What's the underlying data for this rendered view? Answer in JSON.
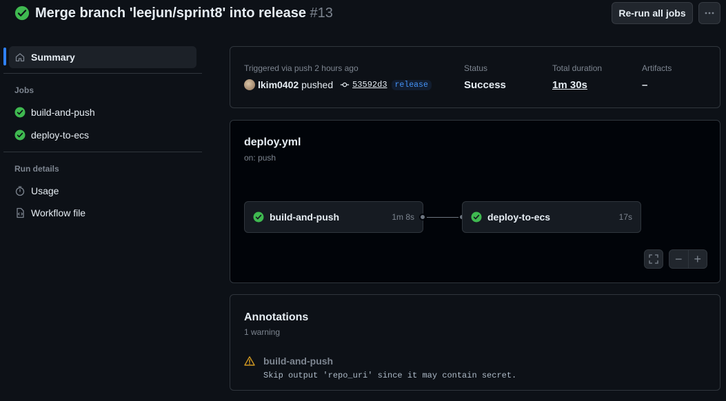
{
  "header": {
    "title": "Merge branch 'leejun/sprint8' into release",
    "run_number": "#13",
    "rerun_label": "Re-run all jobs",
    "more_icon": "kebab-horizontal-icon",
    "status_icon": "check-circle-fill-icon"
  },
  "sidebar": {
    "summary_label": "Summary",
    "jobs_heading": "Jobs",
    "jobs": [
      {
        "label": "build-and-push",
        "icon": "check-circle-fill-icon"
      },
      {
        "label": "deploy-to-ecs",
        "icon": "check-circle-fill-icon"
      }
    ],
    "run_details_heading": "Run details",
    "usage_label": "Usage",
    "workflow_file_label": "Workflow file"
  },
  "summary": {
    "trigger_text": "Triggered via push 2 hours ago",
    "actor": "lkim0402",
    "action": "pushed",
    "commit": "53592d3",
    "branch": "release",
    "status_label": "Status",
    "status_value": "Success",
    "duration_label": "Total duration",
    "duration_value": "1m 30s",
    "artifacts_label": "Artifacts",
    "artifacts_value": "–"
  },
  "graph": {
    "workflow_file": "deploy.yml",
    "trigger": "on: push",
    "jobs": [
      {
        "name": "build-and-push",
        "duration": "1m 8s"
      },
      {
        "name": "deploy-to-ecs",
        "duration": "17s"
      }
    ],
    "zoom_out": "−",
    "zoom_in": "+"
  },
  "annotations": {
    "title": "Annotations",
    "count": "1 warning",
    "items": [
      {
        "job": "build-and-push",
        "message": "Skip output 'repo_uri' since it may contain secret."
      }
    ]
  },
  "colors": {
    "success": "#3fb950",
    "accent": "#2f81f7",
    "warning": "#d29922",
    "background": "#0d1117"
  }
}
